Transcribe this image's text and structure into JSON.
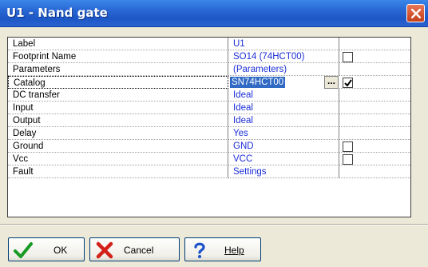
{
  "window": {
    "title": "U1 - Nand gate"
  },
  "grid": {
    "rows": [
      {
        "label": "Label",
        "value": "U1",
        "checkbox": null
      },
      {
        "label": "Footprint Name",
        "value": "SO14 (74HCT00)",
        "checkbox": false
      },
      {
        "label": "Parameters",
        "value": "(Parameters)",
        "checkbox": null
      },
      {
        "label": "Catalog",
        "value": "SN74HCT00",
        "checkbox": true,
        "selected": true
      },
      {
        "label": "DC transfer",
        "value": "Ideal",
        "checkbox": null
      },
      {
        "label": "Input",
        "value": "Ideal",
        "checkbox": null
      },
      {
        "label": "Output",
        "value": "Ideal",
        "checkbox": null
      },
      {
        "label": "Delay",
        "value": "Yes",
        "checkbox": null
      },
      {
        "label": "Ground",
        "value": "GND",
        "checkbox": false
      },
      {
        "label": "Vcc",
        "value": "VCC",
        "checkbox": false
      },
      {
        "label": "Fault",
        "value": "Settings",
        "checkbox": null
      }
    ],
    "ellipsis_label": "..."
  },
  "buttons": {
    "ok": "OK",
    "cancel": "Cancel",
    "help": "Help"
  },
  "colors": {
    "value_text": "#1c2ed8",
    "title_bar": "#2a63d1",
    "selection": "#316ac5"
  }
}
